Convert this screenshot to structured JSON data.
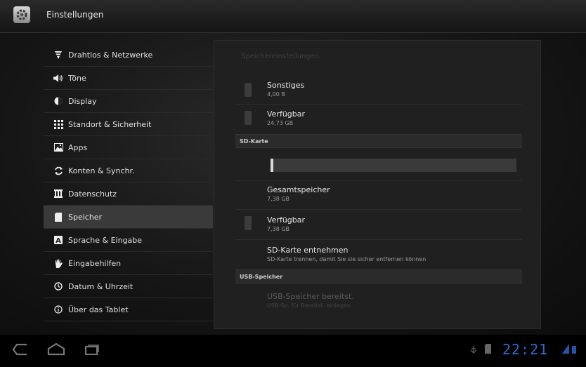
{
  "app": {
    "title": "Einstellungen",
    "icon": "settings-gear-icon"
  },
  "sidebar": {
    "items": [
      {
        "label": "Drahtlos & Netzwerke",
        "icon": "wifi-icon"
      },
      {
        "label": "Töne",
        "icon": "speaker-icon"
      },
      {
        "label": "Display",
        "icon": "brightness-icon"
      },
      {
        "label": "Standort & Sicherheit",
        "icon": "location-grid-icon"
      },
      {
        "label": "Apps",
        "icon": "apps-icon"
      },
      {
        "label": "Konten & Synchr.",
        "icon": "sync-icon"
      },
      {
        "label": "Datenschutz",
        "icon": "privacy-icon"
      },
      {
        "label": "Speicher",
        "icon": "storage-icon",
        "active": true
      },
      {
        "label": "Sprache & Eingabe",
        "icon": "language-icon"
      },
      {
        "label": "Eingabehilfen",
        "icon": "accessibility-hand-icon"
      },
      {
        "label": "Datum & Uhrzeit",
        "icon": "clock-icon"
      },
      {
        "label": "Über das Tablet",
        "icon": "info-icon"
      }
    ]
  },
  "panel": {
    "heading": "Speichereinstellungen",
    "internal": [
      {
        "label": "Sonstiges",
        "value": "4,00 B"
      },
      {
        "label": "Verfügbar",
        "value": "24,73 GB"
      }
    ],
    "sd_section": {
      "title": "SD-Karte",
      "used_fraction": 0.01,
      "total": {
        "label": "Gesamtspeicher",
        "value": "7,38 GB"
      },
      "available": {
        "label": "Verfügbar",
        "value": "7,38 GB"
      },
      "eject": {
        "label": "SD-Karte entnehmen",
        "description": "SD-Karte trennen, damit Sie sie sicher entfernen können"
      }
    },
    "usb_section": {
      "title": "USB-Speicher",
      "mount": {
        "label": "USB-Speicher bereitst.",
        "description": "USB-Sp. für Bereitst. einlegen"
      }
    }
  },
  "navbar": {
    "back_icon": "back-icon",
    "home_icon": "home-icon",
    "recents_icon": "recent-apps-icon",
    "clock": "22:21",
    "accent": "#2a6bd1"
  }
}
